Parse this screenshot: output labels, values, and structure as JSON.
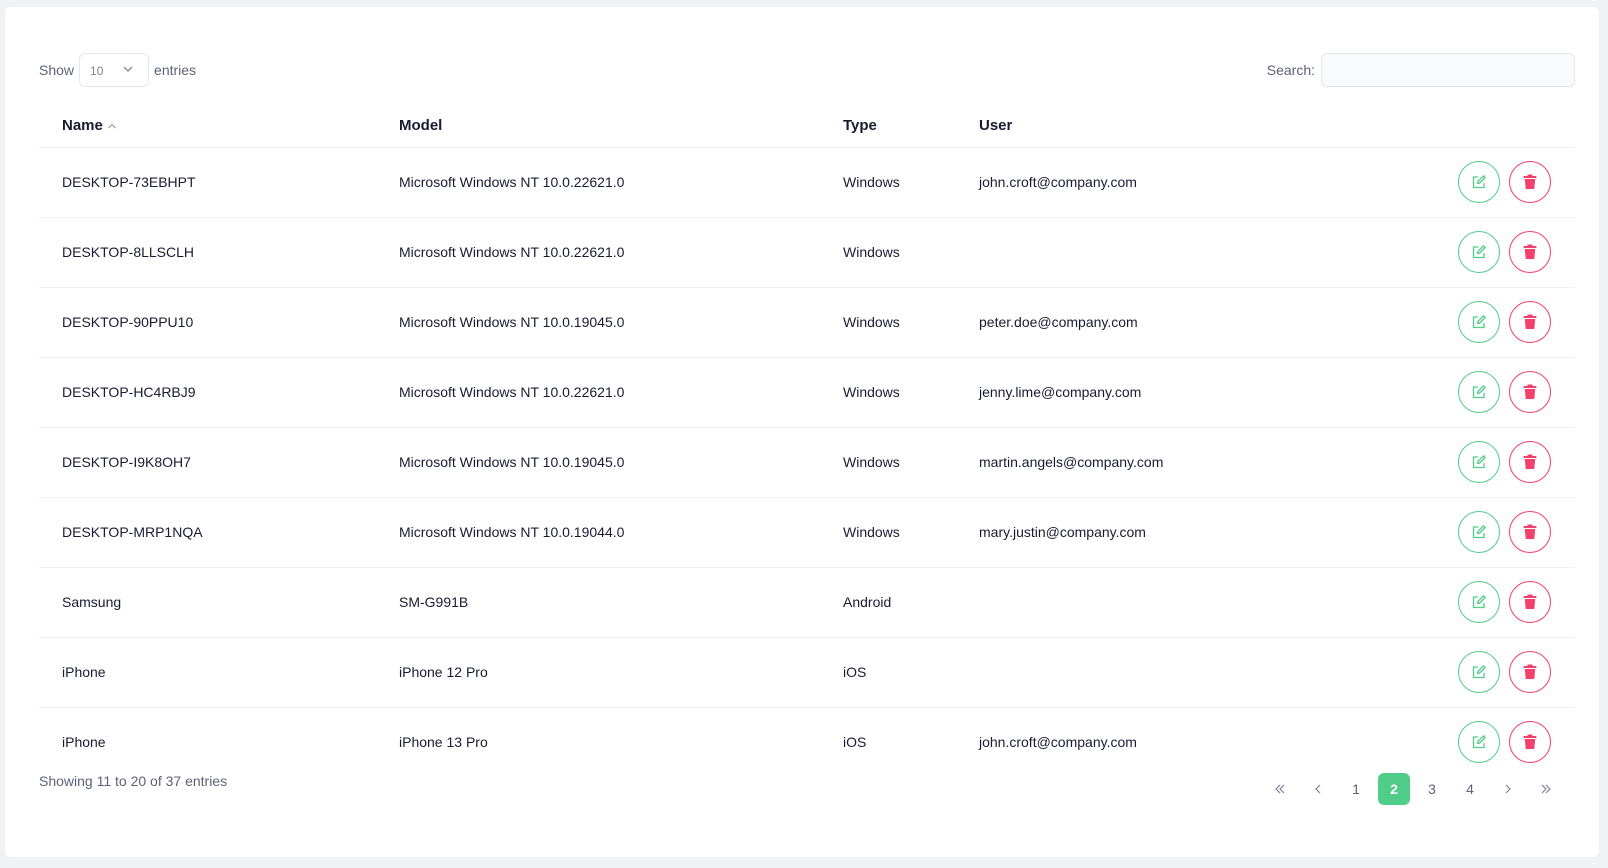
{
  "length_menu": {
    "prefix": "Show",
    "value": "10",
    "suffix": "entries"
  },
  "search": {
    "label": "Search:",
    "placeholder": "",
    "value": ""
  },
  "table": {
    "headers": {
      "name": "Name",
      "model": "Model",
      "type": "Type",
      "user": "User"
    },
    "rows": [
      {
        "name": "DESKTOP-73EBHPT",
        "model": "Microsoft Windows NT 10.0.22621.0",
        "type": "Windows",
        "user": "john.croft@company.com"
      },
      {
        "name": "DESKTOP-8LLSCLH",
        "model": "Microsoft Windows NT 10.0.22621.0",
        "type": "Windows",
        "user": ""
      },
      {
        "name": "DESKTOP-90PPU10",
        "model": "Microsoft Windows NT 10.0.19045.0",
        "type": "Windows",
        "user": "peter.doe@company.com"
      },
      {
        "name": "DESKTOP-HC4RBJ9",
        "model": "Microsoft Windows NT 10.0.22621.0",
        "type": "Windows",
        "user": "jenny.lime@company.com"
      },
      {
        "name": "DESKTOP-I9K8OH7",
        "model": "Microsoft Windows NT 10.0.19045.0",
        "type": "Windows",
        "user": "martin.angels@company.com"
      },
      {
        "name": "DESKTOP-MRP1NQA",
        "model": "Microsoft Windows NT 10.0.19044.0",
        "type": "Windows",
        "user": "mary.justin@company.com"
      },
      {
        "name": "Samsung",
        "model": "SM-G991B",
        "type": "Android",
        "user": ""
      },
      {
        "name": "iPhone",
        "model": "iPhone 12 Pro",
        "type": "iOS",
        "user": ""
      },
      {
        "name": "iPhone",
        "model": "iPhone 13 Pro",
        "type": "iOS",
        "user": "john.croft@company.com"
      }
    ]
  },
  "footer": {
    "info": "Showing 11 to 20 of 37 entries",
    "pages": [
      "1",
      "2",
      "3",
      "4"
    ],
    "current_page": "2"
  },
  "colors": {
    "accent": "#50cd89",
    "danger": "#f1416c"
  },
  "icons": {
    "edit": "edit-icon",
    "delete": "trash-icon",
    "sort": "sort-asc-icon"
  }
}
